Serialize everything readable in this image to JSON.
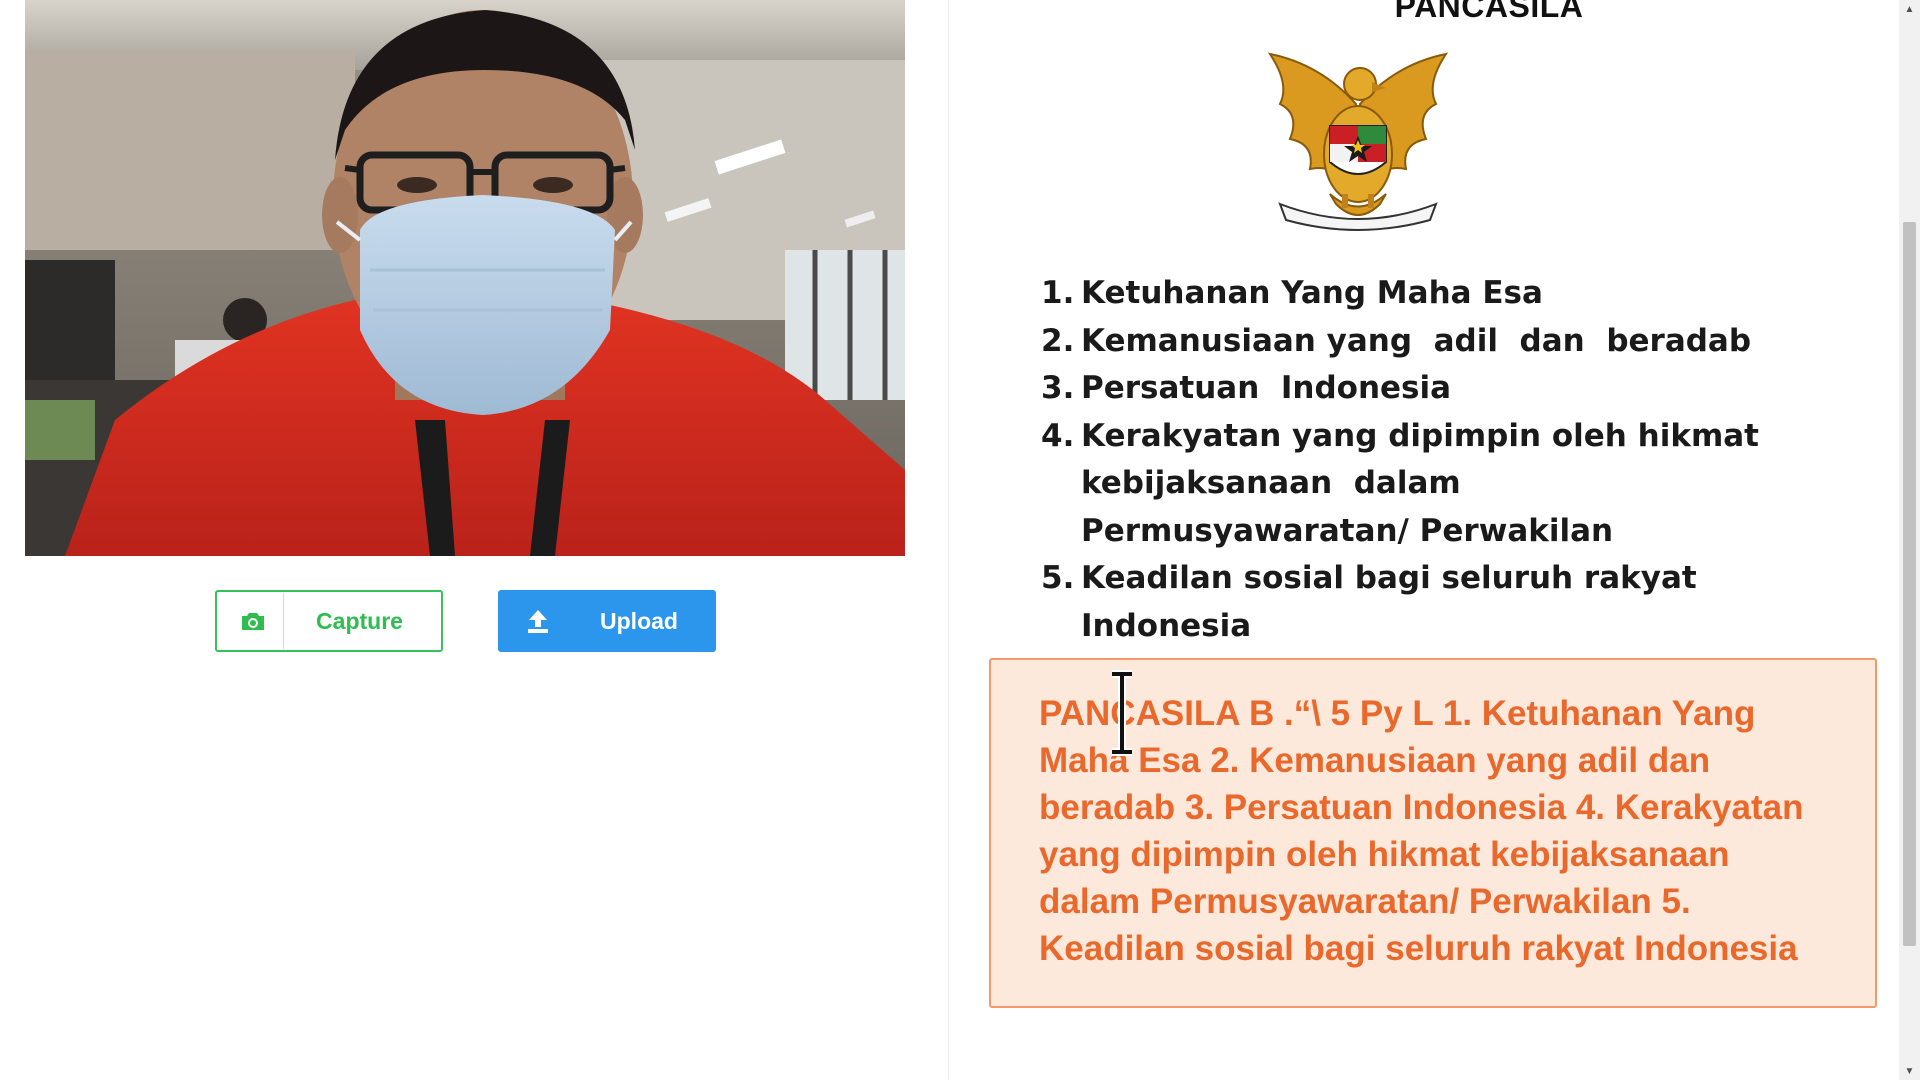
{
  "buttons": {
    "capture_label": "Capture",
    "upload_label": "Upload"
  },
  "slide": {
    "title": "PANCASILA",
    "pillars": [
      {
        "num": "1.",
        "text": "Ketuhanan Yang Maha Esa"
      },
      {
        "num": "2.",
        "text": "Kemanusiaan yang  adil  dan  beradab"
      },
      {
        "num": "3.",
        "text": "Persatuan  Indonesia"
      },
      {
        "num": "4.",
        "text": "Kerakyatan yang dipimpin oleh hikmat kebijaksanaan  dalam Permusyawaratan/ Perwakilan"
      },
      {
        "num": "5.",
        "text": "Keadilan sosial bagi seluruh rakyat Indonesia"
      }
    ]
  },
  "ocr_result": {
    "text": "PANCASILA B .“\\ 5 Py L 1. Ketuhanan Yang Maha Esa 2. Kemanusiaan yang adil dan beradab 3. Persatuan Indonesia 4. Kerakyatan yang dipimpin oleh hikmat kebijaksanaan dalam Permusyawaratan/ Perwakilan 5. Keadilan sosial bagi seluruh rakyat Indonesia"
  },
  "colors": {
    "capture_green": "#2ebd4f",
    "upload_blue": "#2c95ec",
    "result_text_orange": "#e9692c",
    "result_background": "#fde8dc"
  },
  "icons": {
    "capture": "camera-icon",
    "upload": "upload-icon",
    "emblem": "garuda-emblem",
    "cursor": "text-cursor-icon"
  }
}
